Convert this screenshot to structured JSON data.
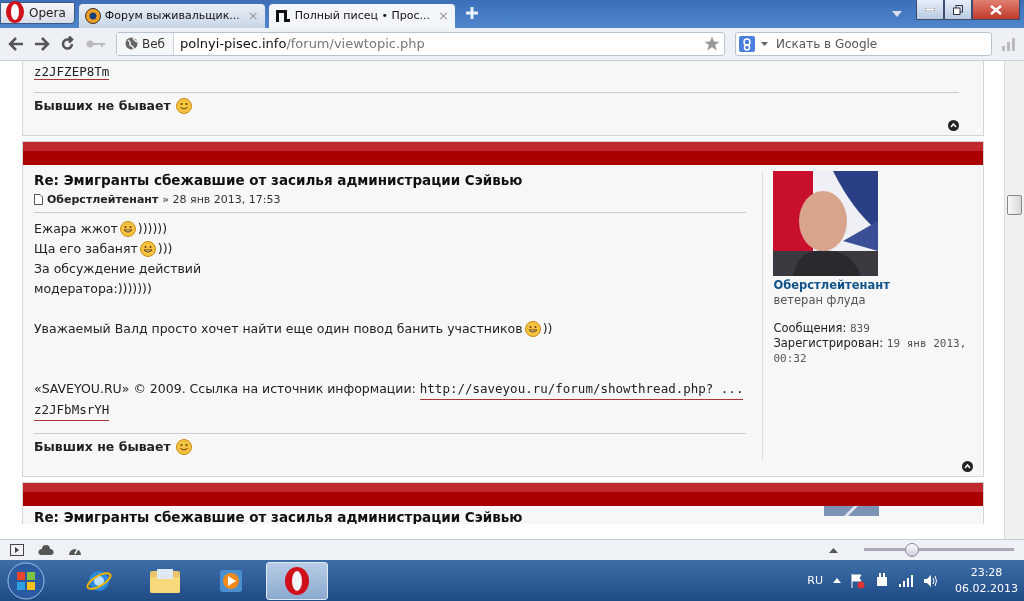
{
  "tabs": [
    {
      "label": "Opera",
      "kind": "menu",
      "selected": false
    },
    {
      "label": "Форум выживальщик...",
      "kind": "tab",
      "selected": false,
      "close": "×"
    },
    {
      "label": "Полный писец • Прос...",
      "kind": "tab",
      "selected": true,
      "close": "×"
    }
  ],
  "address_bar": {
    "badge": "Веб",
    "host": "polnyi-pisec.info",
    "path": "/forum/viewtopic.php"
  },
  "search": {
    "placeholder": "Искать в Google"
  },
  "posts": [
    {
      "kind": "tail",
      "link_tail": "z2JFZEP8Tm",
      "signature": "Бывших не бывает"
    },
    {
      "kind": "full",
      "title": "Re: Эмигранты сбежавшие от засилья администрации Сэйвью",
      "author": "Оберстлейтенант",
      "date": "» 28 янв 2013, 17:53",
      "lines": [
        {
          "text": "Ежара жжот",
          "smiley": true,
          "after": "))))))"
        },
        {
          "text": "Ща его забанят",
          "smiley": true,
          "after": ")))"
        },
        {
          "text": "За обсуждение действий",
          "smiley": false
        },
        {
          "text": "модератора:)))))))",
          "smiley": false
        },
        {
          "text": "Уважаемый Валд просто хочет найти еще один повод банить участников",
          "smiley": true,
          "after": "))",
          "gap": true
        }
      ],
      "source": "«SAVEYOU.RU» © 2009. Ссылка на источник информации:",
      "links": [
        "http://saveyou.ru/forum/showthread.php? ...",
        "z2JFbMsrYH"
      ],
      "signature": "Бывших не бывает",
      "profile": {
        "name": "Оберстлейтенант",
        "rank": "ветеран флуда",
        "posts_label": "Сообщения:",
        "posts": "839",
        "reg_label": "Зарегистрирован:",
        "reg": "19 янв 2013, 00:32"
      }
    },
    {
      "kind": "cut",
      "title": "Re: Эмигранты сбежавшие от засилья администрации Сэйвью"
    }
  ],
  "status_bar": {
    "zoom": {
      "level": 0.31
    }
  },
  "taskbar": {
    "apps": [
      {
        "kind": "ie",
        "selected": false
      },
      {
        "kind": "folder",
        "selected": false
      },
      {
        "kind": "media",
        "selected": false
      },
      {
        "kind": "opera",
        "selected": true
      }
    ],
    "language": "RU",
    "time": "23:28",
    "date": "06.02.2013"
  }
}
